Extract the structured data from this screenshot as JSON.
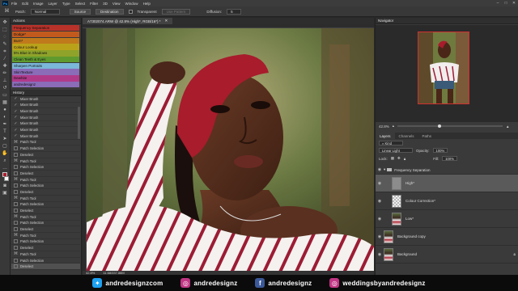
{
  "menubar": {
    "items": [
      "File",
      "Edit",
      "Image",
      "Layer",
      "Type",
      "Select",
      "Filter",
      "3D",
      "View",
      "Window",
      "Help"
    ]
  },
  "options": {
    "patch_label": "Patch:",
    "patch_value": "Normal",
    "source": "Source",
    "destination": "Destination",
    "transparent": "Transparent",
    "use_pattern": "Use Pattern",
    "diffusion_label": "Diffusion:",
    "diffusion_value": "5"
  },
  "actions": {
    "title": "Actions",
    "items": [
      {
        "label": "Frequency Separation",
        "color": "#b8322a"
      },
      {
        "label": "Dodge*",
        "color": "#c25a1e"
      },
      {
        "label": "Burn*",
        "color": "#c07a1c"
      },
      {
        "label": "Colour Lookup",
        "color": "#b9a21a"
      },
      {
        "label": "5% Blue in Shadows",
        "color": "#8fa32a"
      },
      {
        "label": "Clean Teeth & Eyes",
        "color": "#5f9a2e"
      },
      {
        "label": "Sharpen Portraits",
        "color": "#7bb7d8"
      },
      {
        "label": "SkinTexture",
        "color": "#8a6cb8"
      },
      {
        "label": "Dewhite",
        "color": "#b03a8a"
      },
      {
        "label": "andredesignz",
        "color": "#8a6cb8"
      }
    ]
  },
  "history": {
    "title": "History",
    "items": [
      {
        "label": "Mixer Brush",
        "icon": "brush"
      },
      {
        "label": "Mixer Brush",
        "icon": "brush"
      },
      {
        "label": "Mixer Brush",
        "icon": "brush"
      },
      {
        "label": "Mixer Brush",
        "icon": "brush"
      },
      {
        "label": "Mixer Brush",
        "icon": "brush"
      },
      {
        "label": "Mixer Brush",
        "icon": "brush"
      },
      {
        "label": "Mixer Brush",
        "icon": "brush"
      },
      {
        "label": "Patch Tool",
        "icon": "patch"
      },
      {
        "label": "Patch Selection",
        "icon": "box"
      },
      {
        "label": "Deselect",
        "icon": "box"
      },
      {
        "label": "Patch Tool",
        "icon": "patch"
      },
      {
        "label": "Patch Selection",
        "icon": "box"
      },
      {
        "label": "Deselect",
        "icon": "box"
      },
      {
        "label": "Patch Tool",
        "icon": "patch"
      },
      {
        "label": "Patch Selection",
        "icon": "box"
      },
      {
        "label": "Deselect",
        "icon": "box"
      },
      {
        "label": "Patch Tool",
        "icon": "patch"
      },
      {
        "label": "Patch Selection",
        "icon": "box"
      },
      {
        "label": "Deselect",
        "icon": "box"
      },
      {
        "label": "Patch Tool",
        "icon": "patch"
      },
      {
        "label": "Patch Selection",
        "icon": "box"
      },
      {
        "label": "Deselect",
        "icon": "box"
      },
      {
        "label": "Patch Tool",
        "icon": "patch"
      },
      {
        "label": "Patch Selection",
        "icon": "box"
      },
      {
        "label": "Deselect",
        "icon": "box"
      },
      {
        "label": "Patch Tool",
        "icon": "patch"
      },
      {
        "label": "Patch Selection",
        "icon": "box"
      },
      {
        "label": "Deselect",
        "icon": "box"
      }
    ]
  },
  "document": {
    "tab_title": "A7302074.ARW @ 42.8% (High*, RGB/16*) *",
    "status_zoom": "42.8%",
    "status_info": "11.68/337.88M"
  },
  "navigator": {
    "title": "Navigator",
    "zoom": "42.8%"
  },
  "layers_panel": {
    "tabs": [
      "Layers",
      "Channels",
      "Paths"
    ],
    "kind": "Kind",
    "blend_mode": "Linear Light",
    "opacity_label": "Opacity:",
    "opacity_value": "100%",
    "lock_label": "Lock:",
    "fill_label": "Fill:",
    "fill_value": "100%",
    "layers": [
      {
        "name": "Frequency Separation",
        "type": "group"
      },
      {
        "name": "High*",
        "type": "gray"
      },
      {
        "name": "Colour Correction*",
        "type": "checker"
      },
      {
        "name": "Low*",
        "type": "photo"
      },
      {
        "name": "Background copy",
        "type": "photo"
      },
      {
        "name": "Background",
        "type": "photo"
      }
    ]
  },
  "footer": {
    "twitter": "andredesignzcom",
    "instagram": "andredesignz",
    "facebook": "andredesignz",
    "instagram2": "weddingsbyandredesignz"
  },
  "colors": {
    "accent_red": "#b01d2e",
    "twitter": "#1da1f2",
    "instagram": "#c13584",
    "facebook": "#3b5998"
  }
}
